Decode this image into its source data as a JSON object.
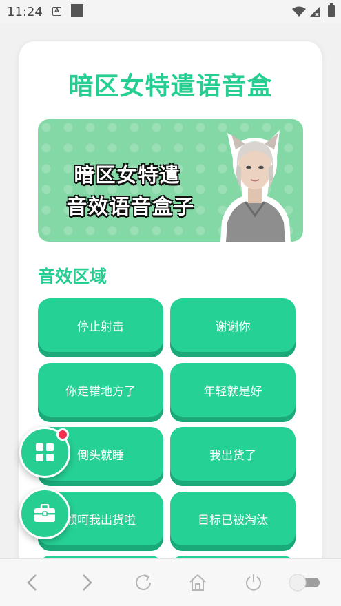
{
  "status_bar": {
    "time": "11:24",
    "notification_icon": "a-icon"
  },
  "app": {
    "title": "暗区女特遣语音盒",
    "accent_color": "#26cf91"
  },
  "banner": {
    "line1": "暗区女特遣",
    "line2": "音效语音盒子"
  },
  "section": {
    "title": "音效区域"
  },
  "sound_buttons": [
    {
      "label": "停止射击"
    },
    {
      "label": "谢谢你"
    },
    {
      "label": "你走错地方了"
    },
    {
      "label": "年轻就是好"
    },
    {
      "label": "倒头就睡"
    },
    {
      "label": "我出货了"
    },
    {
      "label": "领呵我出货啦"
    },
    {
      "label": "目标已被淘汰"
    },
    {
      "label": ""
    },
    {
      "label": ""
    }
  ],
  "floating_buttons": [
    {
      "icon": "grid-icon",
      "has_badge": true
    },
    {
      "icon": "toolbox-icon",
      "has_badge": false
    }
  ],
  "bottom_bar": {
    "icons": [
      "back-icon",
      "forward-icon",
      "refresh-icon",
      "home-icon",
      "power-icon",
      "toggle-switch"
    ]
  }
}
